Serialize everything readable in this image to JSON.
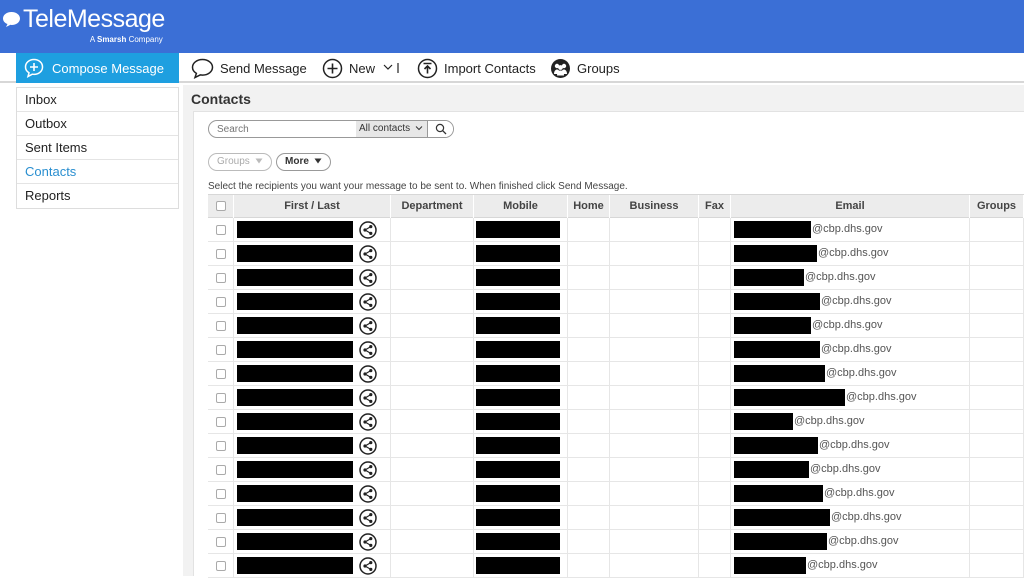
{
  "header": {
    "logo_text": "TeleMessage",
    "logo_tagline_prefix": "A ",
    "logo_tagline_brand": "Smarsh",
    "logo_tagline_suffix": " Company"
  },
  "toolbar": {
    "compose_label": "Compose Message",
    "send_label": "Send Message",
    "new_label": "New",
    "import_label": "Import Contacts",
    "groups_label": "Groups"
  },
  "sidebar": {
    "items": [
      {
        "label": "Inbox"
      },
      {
        "label": "Outbox"
      },
      {
        "label": "Sent Items"
      },
      {
        "label": "Contacts"
      },
      {
        "label": "Reports"
      }
    ]
  },
  "main": {
    "title": "Contacts",
    "search_placeholder": "Search",
    "search_scope": "All contacts",
    "groups_filter": "Groups",
    "more_label": "More",
    "instructions": "Select the recipients you want your message to be sent to. When finished click Send Message."
  },
  "table": {
    "columns": [
      "First / Last",
      "Department",
      "Mobile",
      "Home",
      "Business",
      "Fax",
      "Email",
      "Groups"
    ],
    "rows": [
      {
        "email_domain": "@cbp.dhs.gov"
      },
      {
        "email_domain": "@cbp.dhs.gov"
      },
      {
        "email_domain": "@cbp.dhs.gov"
      },
      {
        "email_domain": "@cbp.dhs.gov"
      },
      {
        "email_domain": "@cbp.dhs.gov"
      },
      {
        "email_domain": "@cbp.dhs.gov"
      },
      {
        "email_domain": "@cbp.dhs.gov"
      },
      {
        "email_domain": "@cbp.dhs.gov"
      },
      {
        "email_domain": "@cbp.dhs.gov"
      },
      {
        "email_domain": "@cbp.dhs.gov"
      },
      {
        "email_domain": "@cbp.dhs.gov"
      },
      {
        "email_domain": "@cbp.dhs.gov"
      },
      {
        "email_domain": "@cbp.dhs.gov"
      },
      {
        "email_domain": "@cbp.dhs.gov"
      },
      {
        "email_domain": "@cbp.dhs.gov"
      }
    ]
  },
  "colors": {
    "header_blue": "#3b6fd6",
    "compose_blue": "#1e9fe0",
    "active_link": "#2a8fd0"
  }
}
